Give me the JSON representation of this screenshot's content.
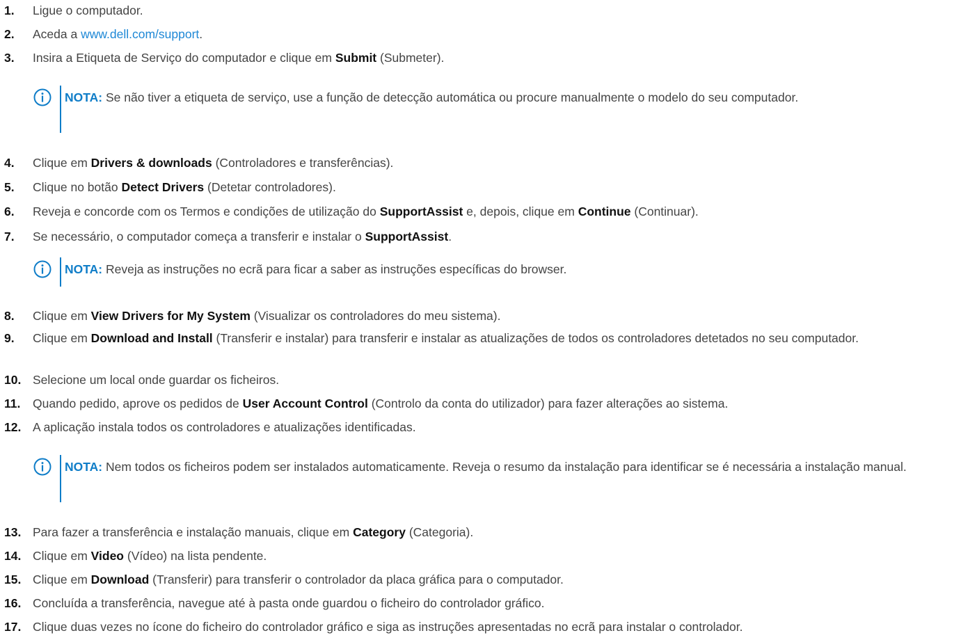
{
  "steps": [
    {
      "n": "1.",
      "parts": [
        {
          "t": "Ligue o computador."
        }
      ]
    },
    {
      "n": "2.",
      "parts": [
        {
          "t": "Aceda a "
        },
        {
          "t": "www.dell.com/support",
          "link": true
        },
        {
          "t": "."
        }
      ]
    },
    {
      "n": "3.",
      "parts": [
        {
          "t": "Insira a Etiqueta de Serviço do computador e clique em "
        },
        {
          "t": "Submit",
          "b": true
        },
        {
          "t": " (Submeter)."
        }
      ]
    },
    {
      "n": "4.",
      "parts": [
        {
          "t": "Clique em "
        },
        {
          "t": "Drivers & downloads",
          "b": true
        },
        {
          "t": " (Controladores e transferências)."
        }
      ]
    },
    {
      "n": "5.",
      "parts": [
        {
          "t": "Clique no botão "
        },
        {
          "t": "Detect Drivers",
          "b": true
        },
        {
          "t": " (Detetar controladores)."
        }
      ]
    },
    {
      "n": "6.",
      "parts": [
        {
          "t": "Reveja e concorde com os Termos e condições de utilização do "
        },
        {
          "t": "SupportAssist",
          "b": true
        },
        {
          "t": " e, depois, clique em "
        },
        {
          "t": "Continue",
          "b": true
        },
        {
          "t": " (Continuar)."
        }
      ]
    },
    {
      "n": "7.",
      "parts": [
        {
          "t": "Se necessário, o computador começa a transferir e instalar o "
        },
        {
          "t": "SupportAssist",
          "b": true
        },
        {
          "t": "."
        }
      ]
    },
    {
      "n": "8.",
      "parts": [
        {
          "t": "Clique em "
        },
        {
          "t": "View Drivers for My System",
          "b": true
        },
        {
          "t": " (Visualizar os controladores do meu sistema)."
        }
      ]
    },
    {
      "n": "9.",
      "parts": [
        {
          "t": "Clique em "
        },
        {
          "t": "Download and Install",
          "b": true
        },
        {
          "t": " (Transferir e instalar) para transferir e instalar as atualizações de todos os controladores detetados no seu computador."
        }
      ]
    },
    {
      "n": "10.",
      "parts": [
        {
          "t": "Selecione um local onde guardar os ficheiros."
        }
      ]
    },
    {
      "n": "11.",
      "parts": [
        {
          "t": "Quando pedido, aprove os pedidos de "
        },
        {
          "t": "User Account Control",
          "b": true
        },
        {
          "t": " (Controlo da conta do utilizador) para fazer alterações ao sistema."
        }
      ]
    },
    {
      "n": "12.",
      "parts": [
        {
          "t": "A aplicação instala todos os controladores e atualizações identificadas."
        }
      ]
    },
    {
      "n": "13.",
      "parts": [
        {
          "t": "Para fazer a transferência e instalação manuais, clique em "
        },
        {
          "t": "Category",
          "b": true
        },
        {
          "t": " (Categoria)."
        }
      ]
    },
    {
      "n": "14.",
      "parts": [
        {
          "t": "Clique em "
        },
        {
          "t": "Video",
          "b": true
        },
        {
          "t": " (Vídeo) na lista pendente."
        }
      ]
    },
    {
      "n": "15.",
      "parts": [
        {
          "t": "Clique em "
        },
        {
          "t": "Download",
          "b": true
        },
        {
          "t": " (Transferir) para transferir o controlador da placa gráfica para o computador."
        }
      ]
    },
    {
      "n": "16.",
      "parts": [
        {
          "t": "Concluída a transferência, navegue até à pasta onde guardou o ficheiro do controlador gráfico."
        }
      ]
    },
    {
      "n": "17.",
      "parts": [
        {
          "t": "Clique duas vezes no ícone do ficheiro do controlador gráfico e siga as instruções apresentadas no ecrã para instalar o controlador."
        }
      ]
    }
  ],
  "notes": [
    {
      "label": "NOTA:",
      "text": " Se não tiver a etiqueta de serviço, use a função de detecção automática ou procure manualmente o modelo do seu computador."
    },
    {
      "label": "NOTA:",
      "text": " Reveja as instruções no ecrã para ficar a saber as instruções específicas do browser."
    },
    {
      "label": "NOTA:",
      "text": " Nem todos os ficheiros podem ser instalados automaticamente. Reveja o resumo da instalação para identificar se é necessária a instalação manual."
    }
  ],
  "colors": {
    "text": "#444444",
    "number": "#111111",
    "link": "#1e88d6",
    "note_accent": "#0f7dc8"
  },
  "icons": {
    "note": "info-circle-icon"
  }
}
